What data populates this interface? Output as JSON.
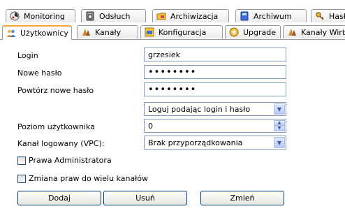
{
  "tabs_row1": [
    {
      "label": "Monitoring",
      "icon": "monitoring-icon"
    },
    {
      "label": "Odsłuch",
      "icon": "speaker-icon"
    },
    {
      "label": "Archiwizacja",
      "icon": "archive-folder-icon"
    },
    {
      "label": "Archiwum",
      "icon": "archive-icon"
    },
    {
      "label": "Hasło",
      "icon": "key-icon"
    }
  ],
  "tabs_row2": [
    {
      "label": "Użytkownicy",
      "icon": "users-icon",
      "active": true
    },
    {
      "label": "Kanały",
      "icon": "channels-icon"
    },
    {
      "label": "Konfiguracja",
      "icon": "configuration-icon"
    },
    {
      "label": "Upgrade",
      "icon": "upgrade-icon"
    },
    {
      "label": "Kanały Wirtualne",
      "icon": "virtual-channels-icon"
    }
  ],
  "form": {
    "login_label": "Login",
    "login_value": "grzesiek",
    "new_password_label": "Nowe hasło",
    "new_password_value": "••••••••",
    "repeat_password_label": "Powtórz nowe hasło",
    "repeat_password_value": "••••••••",
    "login_mode_value": "Loguj podając login i hasło",
    "user_level_label": "Poziom użytkownika",
    "user_level_value": "0",
    "channel_label": "Kanał logowany (VPC):",
    "channel_value": "Brak przyporządkowania",
    "admin_rights_label": "Prawa Administratora",
    "multi_channel_label": "Zmiana praw do wielu kanałów"
  },
  "buttons": {
    "add": "Dodaj",
    "delete": "Usuń",
    "change": "Zmień"
  },
  "colors": {
    "active_tab_accent": "#f3a43b",
    "field_border": "#7f9db9",
    "button_border": "#003c74"
  }
}
